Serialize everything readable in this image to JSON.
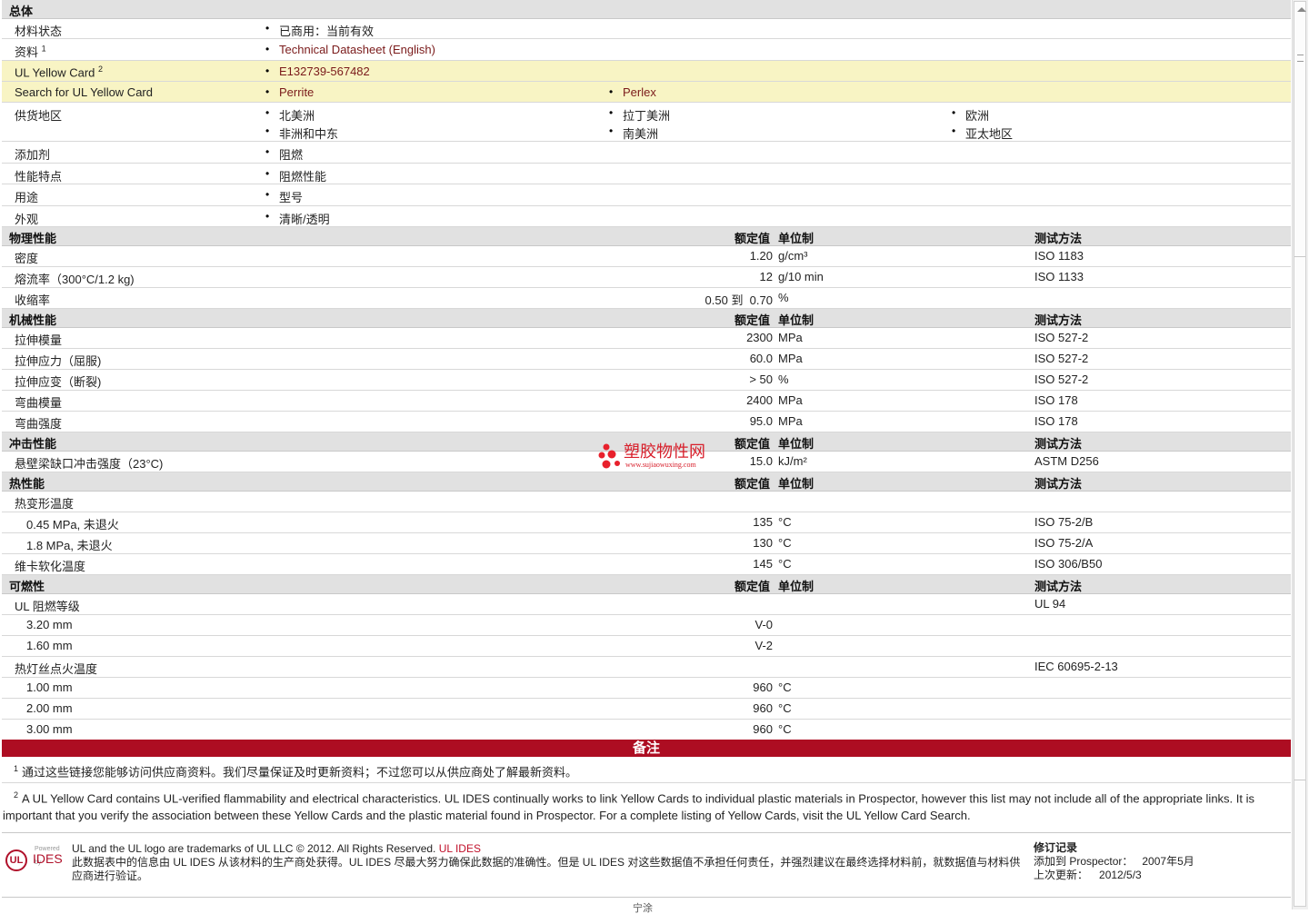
{
  "general": {
    "section_title": "总体",
    "status_label": "材料状态",
    "status_value": "已商用：当前有效",
    "docs_label": "资料",
    "docs_sup": "1",
    "docs_link": "Technical Datasheet (English)",
    "ulcard_label": "UL Yellow Card",
    "ulcard_sup": "2",
    "ulcard_link": "E132739-567482",
    "search_label": "Search for UL Yellow Card",
    "search_links": [
      "Perrite",
      "Perlex"
    ],
    "regions_label": "供货地区",
    "regions": [
      "北美洲",
      "拉丁美洲",
      "欧洲",
      "非洲和中东",
      "南美洲",
      "亚太地区"
    ],
    "additive_label": "添加剂",
    "additive_value": "阻燃",
    "features_label": "性能特点",
    "features_value": "阻燃性能",
    "uses_label": "用途",
    "uses_value": "型号",
    "appearance_label": "外观",
    "appearance_value": "清晰/透明"
  },
  "headers": {
    "nominal": "额定值",
    "unit": "单位制",
    "method": "测试方法"
  },
  "physical": {
    "title": "物理性能",
    "rows": [
      {
        "name": "密度",
        "value": "1.20",
        "unit": "g/cm³",
        "method": "ISO 1183"
      },
      {
        "name": "熔流率（300°C/1.2 kg)",
        "value": "12",
        "unit": "g/10 min",
        "method": "ISO 1133"
      },
      {
        "name": "收缩率",
        "value": "0.50 到  0.70",
        "unit": "%",
        "method": ""
      }
    ]
  },
  "mechanical": {
    "title": "机械性能",
    "rows": [
      {
        "name": "拉伸模量",
        "value": "2300",
        "unit": "MPa",
        "method": "ISO 527-2"
      },
      {
        "name": "拉伸应力（屈服)",
        "value": "60.0",
        "unit": "MPa",
        "method": "ISO 527-2"
      },
      {
        "name": "拉伸应变（断裂)",
        "value": "> 50",
        "unit": "%",
        "method": "ISO 527-2"
      },
      {
        "name": "弯曲模量",
        "value": "2400",
        "unit": "MPa",
        "method": "ISO 178"
      },
      {
        "name": "弯曲强度",
        "value": "95.0",
        "unit": "MPa",
        "method": "ISO 178"
      }
    ]
  },
  "impact": {
    "title": "冲击性能",
    "rows": [
      {
        "name": "悬壁梁缺口冲击强度（23°C)",
        "value": "15.0",
        "unit": "kJ/m²",
        "method": "ASTM D256"
      }
    ]
  },
  "thermal": {
    "title": "热性能",
    "hdt_label": "热变形温度",
    "rows": [
      {
        "name": "0.45 MPa, 未退火",
        "value": "135",
        "unit": "°C",
        "method": "ISO 75-2/B"
      },
      {
        "name": "1.8 MPa, 未退火",
        "value": "130",
        "unit": "°C",
        "method": "ISO 75-2/A"
      }
    ],
    "vicat": {
      "name": "维卡软化温度",
      "value": "145",
      "unit": "°C",
      "method": "ISO 306/B50"
    }
  },
  "flammability": {
    "title": "可燃性",
    "ul_label": "UL 阻燃等级",
    "ul_method": "UL 94",
    "ul_rows": [
      {
        "name": "3.20 mm",
        "value": "V-0"
      },
      {
        "name": "1.60 mm",
        "value": "V-2"
      }
    ],
    "gwit_label": "热灯丝点火温度",
    "gwit_method": "IEC 60695-2-13",
    "gwit_rows": [
      {
        "name": "1.00 mm",
        "value": "960",
        "unit": "°C"
      },
      {
        "name": "2.00 mm",
        "value": "960",
        "unit": "°C"
      },
      {
        "name": "3.00 mm",
        "value": "960",
        "unit": "°C"
      }
    ]
  },
  "notes": {
    "title": "备注",
    "n1_sup": "1",
    "n1": "通过这些链接您能够访问供应商资料。我们尽量保证及时更新资料；不过您可以从供应商处了解最新资料。",
    "n2_sup": "2",
    "n2": "A UL Yellow Card contains UL-verified flammability and electrical characteristics. UL IDES continually works to link Yellow Cards to individual plastic materials in Prospector, however this list may not include all of the appropriate links. It is important that you verify the association between these Yellow Cards and the plastic material found in Prospector. For a complete listing of Yellow Cards, visit the UL Yellow Card Search."
  },
  "footer": {
    "powered_by": "Powered by",
    "logo_ul": "UL",
    "logo_ides": "IDES",
    "trademark": "UL and the UL logo are trademarks of UL LLC © 2012. All Rights Reserved.",
    "ul_ides_link": "UL IDES",
    "disclaimer": "此数据表中的信息由  UL IDES 从该材料的生产商处获得。UL IDES 尽最大努力确保此数据的准确性。但是  UL IDES 对这些数据值不承担任何责任，并强烈建议在最终选择材料前，就数据值与材料供应商进行验证。",
    "revision_title": "修订记录",
    "added_label": "添加到  Prospector：",
    "added_value": "2007年5月",
    "updated_label": "上次更新：",
    "updated_value": "2012/5/3",
    "cut_text": "宁涂"
  },
  "watermark": {
    "text": "塑胶物性网",
    "url": "www.sujiaowuxing.com"
  },
  "colors": {
    "notes_bar": "#ad0d22",
    "highlight_row": "#f8f4c4",
    "section_bg": "#e1e1e1",
    "link": "#7a1a1a"
  }
}
